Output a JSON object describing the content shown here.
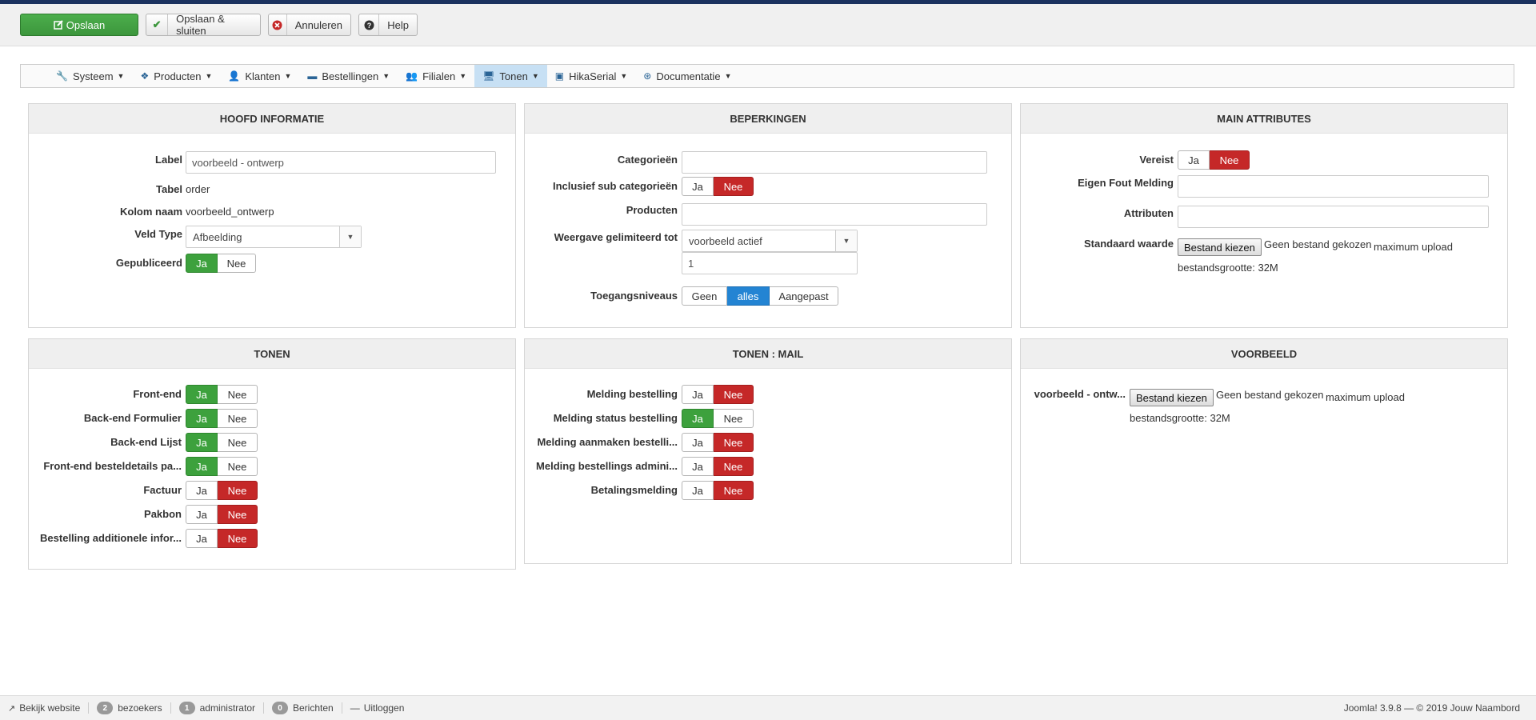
{
  "toolbar": {
    "save": "Opslaan",
    "save_close": "Opslaan & sluiten",
    "cancel": "Annuleren",
    "help": "Help"
  },
  "menu": [
    {
      "label": "Systeem",
      "icon": "wrench-icon"
    },
    {
      "label": "Producten",
      "icon": "cubes-icon"
    },
    {
      "label": "Klanten",
      "icon": "user-icon"
    },
    {
      "label": "Bestellingen",
      "icon": "credit-card-icon"
    },
    {
      "label": "Filialen",
      "icon": "users-icon"
    },
    {
      "label": "Tonen",
      "icon": "monitor-icon",
      "active": true
    },
    {
      "label": "HikaSerial",
      "icon": "id-card-icon"
    },
    {
      "label": "Documentatie",
      "icon": "lifebuoy-icon"
    }
  ],
  "hoofd": {
    "title": "HOOFD INFORMATIE",
    "label_lbl": "Label",
    "label_val": "voorbeeld - ontwerp",
    "tabel_lbl": "Tabel",
    "tabel_val": "order",
    "kolom_lbl": "Kolom naam",
    "kolom_val": "voorbeeld_ontwerp",
    "veld_lbl": "Veld Type",
    "veld_val": "Afbeelding",
    "gepub_lbl": "Gepubliceerd",
    "ja": "Ja",
    "nee": "Nee"
  },
  "beperkingen": {
    "title": "BEPERKINGEN",
    "cat_lbl": "Categorieën",
    "incl_lbl": "Inclusief sub categorieën",
    "prod_lbl": "Producten",
    "weergave_lbl": "Weergave gelimiteerd tot",
    "weergave_val": "voorbeeld actief",
    "weergave_num": "1",
    "toegang_lbl": "Toegangsniveaus",
    "toegang_opts": [
      "Geen",
      "alles",
      "Aangepast"
    ],
    "ja": "Ja",
    "nee": "Nee"
  },
  "main_attr": {
    "title": "MAIN ATTRIBUTES",
    "vereist_lbl": "Vereist",
    "fout_lbl": "Eigen Fout Melding",
    "attr_lbl": "Attributen",
    "standaard_lbl": "Standaard waarde",
    "file_btn": "Bestand kiezen",
    "no_file": "Geen bestand gekozen",
    "max_upload": "maximum upload",
    "size": "bestandsgrootte: 32M",
    "ja": "Ja",
    "nee": "Nee"
  },
  "tonen": {
    "title": "TONEN",
    "rows": [
      {
        "label": "Front-end",
        "ja": true
      },
      {
        "label": "Back-end Formulier",
        "ja": true
      },
      {
        "label": "Back-end Lijst",
        "ja": true
      },
      {
        "label": "Front-end besteldetails pa...",
        "ja": true
      },
      {
        "label": "Factuur",
        "ja": false
      },
      {
        "label": "Pakbon",
        "ja": false
      },
      {
        "label": "Bestelling additionele infor...",
        "ja": false
      }
    ],
    "ja": "Ja",
    "nee": "Nee"
  },
  "tonen_mail": {
    "title": "TONEN : MAIL",
    "rows": [
      {
        "label": "Melding bestelling",
        "ja": false
      },
      {
        "label": "Melding status bestelling",
        "ja": true
      },
      {
        "label": "Melding aanmaken bestelli...",
        "ja": false
      },
      {
        "label": "Melding bestellings admini...",
        "ja": false
      },
      {
        "label": "Betalingsmelding",
        "ja": false
      }
    ],
    "ja": "Ja",
    "nee": "Nee"
  },
  "voorbeeld": {
    "title": "VOORBEELD",
    "label": "voorbeeld - ontw...",
    "file_btn": "Bestand kiezen",
    "no_file": "Geen bestand gekozen",
    "max_upload": "maximum upload",
    "size": "bestandsgrootte: 32M"
  },
  "status": {
    "site": "Bekijk website",
    "visitors_count": "2",
    "visitors": "bezoekers",
    "admin_count": "1",
    "admin": "administrator",
    "msg_count": "0",
    "messages": "Berichten",
    "logout": "Uitloggen",
    "version": "Joomla! 3.9.8 — © 2019 Jouw Naambord"
  }
}
